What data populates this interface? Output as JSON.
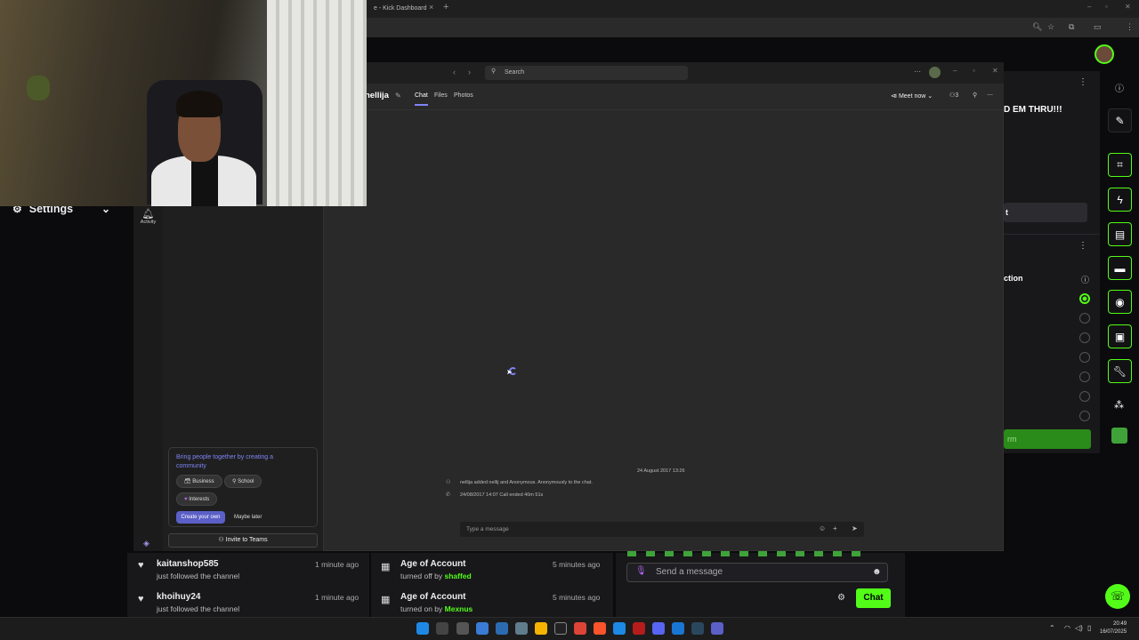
{
  "browser": {
    "tab_title": "e - Kick Dashboard",
    "tab_close": "×",
    "new_tab": "+"
  },
  "kick": {
    "settings_label": "Settings",
    "right_panel": {
      "headline": "D EM THRU!!!",
      "button_partial": "t",
      "section_label": "ction",
      "green_partial": "rm"
    }
  },
  "teams": {
    "search_placeholder": "Search",
    "chat_name": "nellija",
    "tabs": [
      "Chat",
      "Files",
      "Photos"
    ],
    "meet_now": "Meet now",
    "participants": "3",
    "activity_label": "Activity",
    "date_separator": "24 August 2017 13:26",
    "messages": [
      "nellija added nellij and Anonymous. Anonymously to the chat.",
      "24/08/2017 14:07  Call ended 40m 51s"
    ],
    "compose_placeholder": "Type a message",
    "community": {
      "title": "Bring people together by creating a community",
      "chips": [
        "Business",
        "School",
        "Interests"
      ],
      "create_label": "Create your own",
      "later_label": "Maybe later"
    },
    "invite_label": "Invite to Teams"
  },
  "feed": {
    "left": [
      {
        "name": "kaitanshop585",
        "sub": "just followed the channel",
        "time": "1 minute ago"
      },
      {
        "name": "khoihuy24",
        "sub": "just followed the channel",
        "time": "1 minute ago"
      }
    ],
    "right": [
      {
        "name": "Age of Account",
        "sub_prefix": "turned off by",
        "user": "shaffed",
        "time": "5 minutes ago"
      },
      {
        "name": "Age of Account",
        "sub_prefix": "turned on by",
        "user": "Mexnus",
        "time": "5 minutes ago"
      }
    ]
  },
  "chat": {
    "placeholder": "Send a message",
    "button": "Chat"
  },
  "clock": {
    "time": "20:49",
    "date": "16/07/2025"
  },
  "colors": {
    "kick_green": "#53fc18",
    "teams_purple": "#7f85f5"
  }
}
